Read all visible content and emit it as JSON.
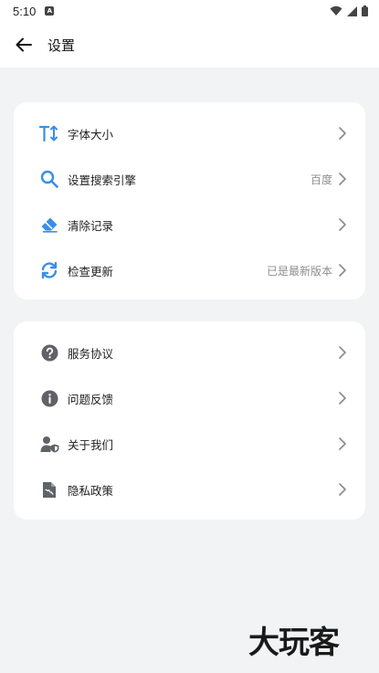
{
  "status_bar": {
    "time": "5:10",
    "notification_glyph": "A"
  },
  "header": {
    "title": "设置",
    "back_icon": "arrow-left-icon"
  },
  "colors": {
    "accent_blue": "#3a8ee6",
    "icon_gray": "#5f6368",
    "chevron": "#8a8a8a"
  },
  "group1": {
    "items": [
      {
        "label": "字体大小",
        "value": "",
        "icon": "font-size-icon"
      },
      {
        "label": "设置搜索引擎",
        "value": "百度",
        "icon": "search-icon"
      },
      {
        "label": "清除记录",
        "value": "",
        "icon": "eraser-icon"
      },
      {
        "label": "检查更新",
        "value": "已是最新版本",
        "icon": "refresh-icon"
      }
    ]
  },
  "group2": {
    "items": [
      {
        "label": "服务协议",
        "value": "",
        "icon": "question-icon"
      },
      {
        "label": "问题反馈",
        "value": "",
        "icon": "info-icon"
      },
      {
        "label": "关于我们",
        "value": "",
        "icon": "user-shield-icon"
      },
      {
        "label": "隐私政策",
        "value": "",
        "icon": "document-icon"
      }
    ]
  },
  "watermark": {
    "text": "大玩客"
  }
}
